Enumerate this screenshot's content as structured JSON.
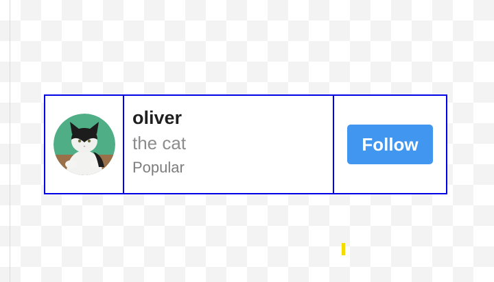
{
  "card": {
    "avatar": {
      "alt": "oliver",
      "icon": "cat-avatar-photo"
    },
    "name": "oliver",
    "subtitle": "the cat",
    "tag": "Popular",
    "follow_label": "Follow"
  },
  "colors": {
    "border": "#0000e6",
    "button": "#4196f0",
    "marker": "#f5dc00"
  }
}
